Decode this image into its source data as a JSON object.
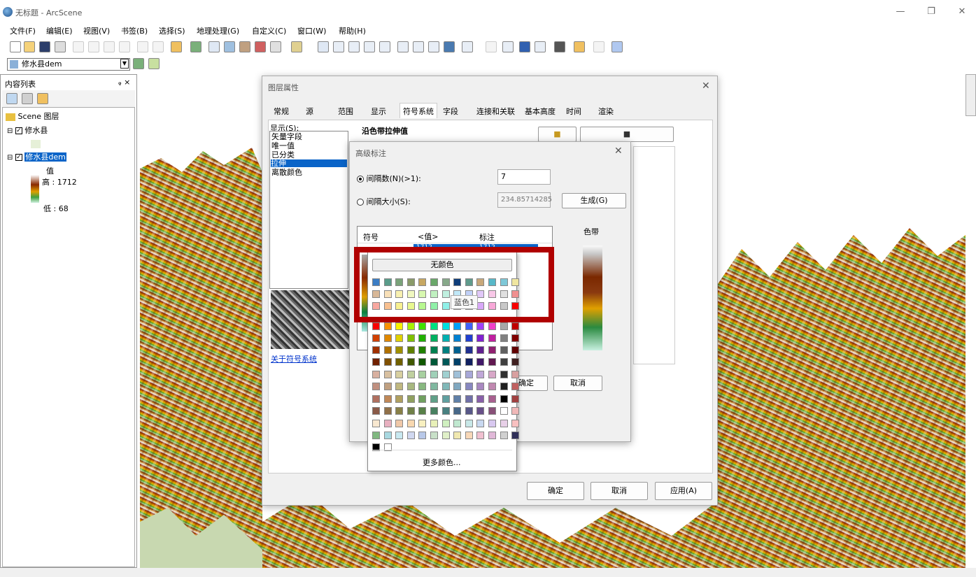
{
  "window": {
    "title": "无标题 - ArcScene"
  },
  "menu": [
    "文件(F)",
    "编辑(E)",
    "视图(V)",
    "书签(B)",
    "选择(S)",
    "地理处理(G)",
    "自定义(C)",
    "窗口(W)",
    "帮助(H)"
  ],
  "layer_selector": {
    "value": "修水县dem"
  },
  "toc": {
    "title": "内容列表",
    "pin": "ᵩ ×",
    "root": "Scene 图层",
    "layer1": "修水县",
    "layer2": "修水县dem",
    "value_label": "值",
    "high": "高 : 1712",
    "low": "低 : 68"
  },
  "layer_props": {
    "title": "图层属性",
    "tabs": [
      "常规",
      "源",
      "范围",
      "显示",
      "符号系统",
      "字段",
      "连接和关联",
      "基本高度",
      "时间",
      "渲染"
    ],
    "active_tab": "符号系统",
    "show_label": "显示(S):",
    "show_items": [
      "矢量字段",
      "唯一值",
      "已分类",
      "拉伸",
      "离散颜色"
    ],
    "selected_show": "拉伸",
    "heading": "沿色带拉伸值",
    "about_link": "关于符号系统",
    "ok": "确定",
    "cancel": "取消",
    "apply": "应用(A)"
  },
  "adv_label": {
    "title": "高级标注",
    "interval_count_label": "间隔数(N)(>1):",
    "interval_count_value": "7",
    "interval_size_label": "间隔大小(S):",
    "interval_size_value": "234.85714285",
    "generate": "生成(G)",
    "col_symbol": "符号",
    "col_value": "<值>",
    "col_label": "标注",
    "row1_value": "1712",
    "row1_label": "1712",
    "ramp_label": "色带",
    "ok": "确定",
    "cancel": "取消"
  },
  "palette": {
    "no_color": "无颜色",
    "tooltip": "蓝色1",
    "more": "更多颜色...",
    "colors": [
      [
        "#3b7dc4",
        "#5a9c8a",
        "#7aa37a",
        "#8a9b6a",
        "#c7a862",
        "#6aa86a",
        "#87a98a",
        "#0f3d7a",
        "#5f9b8c",
        "#c8a87a",
        "#58b8c8",
        "#7ec8d8",
        "#f0e6a0"
      ],
      [
        "#d8b898",
        "#f8e0b8",
        "#f8f0b0",
        "#f0f8c0",
        "#d8f8b0",
        "#c0f0c0",
        "#c0f0e0",
        "#c0e8f8",
        "#c0d0f8",
        "#e0c8f8",
        "#f8c8e8",
        "#e0e0e0",
        "#f09090"
      ],
      [
        "#f8a8a0",
        "#f8c090",
        "#f8f090",
        "#e8f890",
        "#b8f890",
        "#90f0a8",
        "#90f0e8",
        "#90e0f8",
        "#a8b8f8",
        "#d8a8f8",
        "#f8a8d8",
        "#c8c8c8",
        "#f80000"
      ],
      [
        "#f80000",
        "#f89000",
        "#f8f000",
        "#a8f000",
        "#40e000",
        "#00e080",
        "#00e0e0",
        "#00a0f8",
        "#4060f8",
        "#a040f8",
        "#f040c8",
        "#a8a8a8",
        "#c00000"
      ],
      [
        "#d04000",
        "#e08800",
        "#e0d000",
        "#80c000",
        "#20b000",
        "#00b060",
        "#00b0b0",
        "#0080d0",
        "#2040d0",
        "#8020d0",
        "#c020a0",
        "#808080",
        "#800000"
      ],
      [
        "#a03000",
        "#b07000",
        "#a09000",
        "#608000",
        "#208000",
        "#008050",
        "#008080",
        "#006090",
        "#203090",
        "#602090",
        "#902070",
        "#606060",
        "#600000"
      ],
      [
        "#702000",
        "#805000",
        "#706000",
        "#405800",
        "#105800",
        "#005838",
        "#005858",
        "#004068",
        "#102060",
        "#401868",
        "#601850",
        "#404040",
        "#402020"
      ],
      [
        "#d8b0a0",
        "#d8c0a0",
        "#d8d0a0",
        "#c0d0a0",
        "#a8d0a0",
        "#a0d0b8",
        "#a0d0d0",
        "#a0c0d8",
        "#a8a8d8",
        "#c0a8d8",
        "#d8a8c8",
        "#303030",
        "#d8a0a0"
      ],
      [
        "#c09080",
        "#c0a080",
        "#c0b880",
        "#a8b880",
        "#88b880",
        "#80b8a0",
        "#80b8b8",
        "#80a8c0",
        "#8888c0",
        "#a888c0",
        "#c088b0",
        "#202020",
        "#c06060"
      ],
      [
        "#b07060",
        "#c08858",
        "#b0a060",
        "#90a060",
        "#70a060",
        "#60a088",
        "#60a0a0",
        "#6080a8",
        "#7070a8",
        "#8860a8",
        "#a86090",
        "#000000",
        "#a04040"
      ],
      [
        "#8a5a48",
        "#907048",
        "#888048",
        "#708048",
        "#588048",
        "#488060",
        "#488080",
        "#486888",
        "#585888",
        "#685088",
        "#885078",
        "#ffffff",
        "#f0b8b8"
      ],
      [
        "#f8e8d0",
        "#e8b0c0",
        "#f0c8a8",
        "#f8d8b0",
        "#f8f0c0",
        "#e8f0b8",
        "#d0f0c0",
        "#c0e8d0",
        "#c8e8e8",
        "#c8d8f0",
        "#d8c8f0",
        "#e8d0e8",
        "#f8c0c0"
      ],
      [
        "#80b880",
        "#a8d8e0",
        "#c8e8f0",
        "#d0d8f0",
        "#b8c8e8",
        "#c8e0c8",
        "#e0f0c8",
        "#f0e8b0",
        "#f8d8b8",
        "#f0c0d0",
        "#e0b8d8",
        "#d0d0d0",
        "#303058"
      ],
      [
        "#000000",
        "#ffffff"
      ]
    ]
  }
}
